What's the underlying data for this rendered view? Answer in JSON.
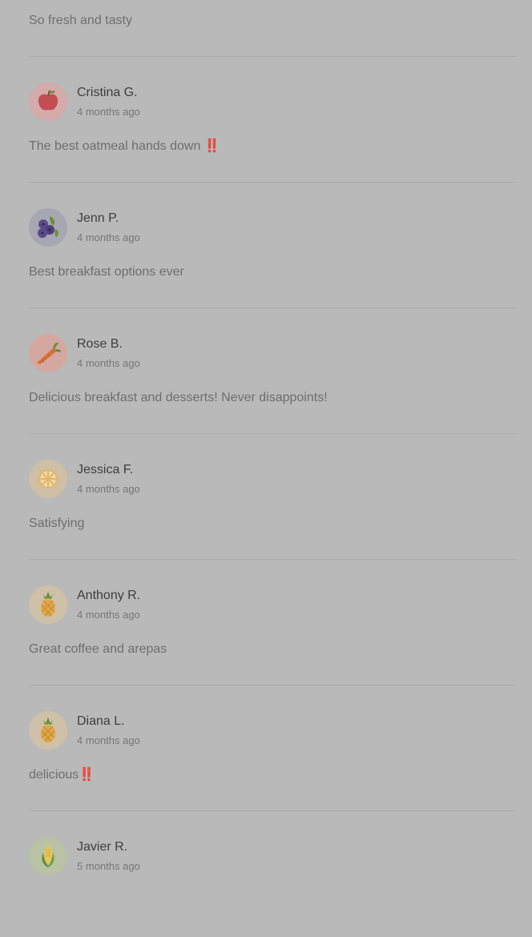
{
  "first_review_text": "So fresh and tasty",
  "reviews": [
    {
      "name": "Cristina G.",
      "time": "4 months ago",
      "text": "The best oatmeal hands down ‼️",
      "avatar_icon": "apple-icon",
      "avatar_bg": "#d4aaaa"
    },
    {
      "name": "Jenn P.",
      "time": "4 months ago",
      "text": "Best breakfast options ever",
      "avatar_icon": "blueberry-icon",
      "avatar_bg": "#a7a7b3"
    },
    {
      "name": "Rose B.",
      "time": "4 months ago",
      "text": "Delicious breakfast and desserts! Never disappoints!",
      "avatar_icon": "carrot-icon",
      "avatar_bg": "#d4a8a0"
    },
    {
      "name": "Jessica F.",
      "time": "4 months ago",
      "text": "Satisfying",
      "avatar_icon": "orange-slice-icon",
      "avatar_bg": "#cfbfa5"
    },
    {
      "name": "Anthony R.",
      "time": "4 months ago",
      "text": "Great coffee and arepas",
      "avatar_icon": "pineapple-icon",
      "avatar_bg": "#cfc0a8"
    },
    {
      "name": "Diana L.",
      "time": "4 months ago",
      "text": "delicious‼️",
      "avatar_icon": "pineapple-icon",
      "avatar_bg": "#cfc0a8"
    },
    {
      "name": "Javier R.",
      "time": "5 months ago",
      "text": "",
      "avatar_icon": "corn-icon",
      "avatar_bg": "#b9c2a4"
    }
  ]
}
